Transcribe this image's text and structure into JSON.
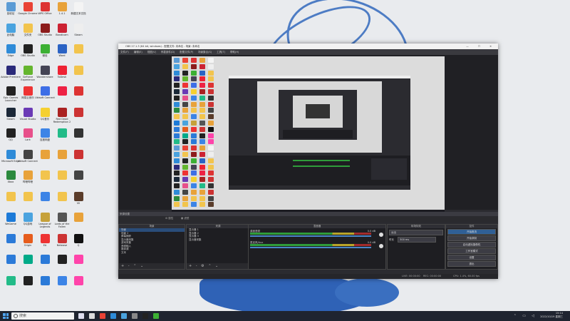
{
  "desktop_icons": [
    {
      "label": "回收站",
      "color": "#5b9bd5"
    },
    {
      "label": "Google Chrome",
      "color": "#e94235"
    },
    {
      "label": "WPS Office",
      "color": "#d33"
    },
    {
      "label": "1.4.1",
      "color": "#e8a23a"
    },
    {
      "label": "新建文本文档",
      "color": "#f4f4f4"
    },
    {
      "label": "此电脑",
      "color": "#4aa3df"
    },
    {
      "label": "文件夹",
      "color": "#f2c44d"
    },
    {
      "label": "OBS Studio",
      "color": "#8c1c1c"
    },
    {
      "label": "Bandicam",
      "color": "#c23"
    },
    {
      "label": "Steam",
      "color": "#eee"
    },
    {
      "label": "Edge",
      "color": "#2e8bd8"
    },
    {
      "label": "OBS Studio",
      "color": "#222"
    },
    {
      "label": "微信",
      "color": "#3cb034"
    },
    {
      "label": "Word",
      "color": "#2b63c4"
    },
    {
      "label": "",
      "color": "#f2c44d"
    },
    {
      "label": "Adobe Premiere",
      "color": "#2a2a7a"
    },
    {
      "label": "GeForce Experience",
      "color": "#64b52e"
    },
    {
      "label": "Wondershare",
      "color": "#445"
    },
    {
      "label": "ToDesk",
      "color": "#e23"
    },
    {
      "label": "",
      "color": "#f2c44d"
    },
    {
      "label": "Epic Games Launcher",
      "color": "#222"
    },
    {
      "label": "网易云音乐",
      "color": "#e33"
    },
    {
      "label": "Ubisoft Connect",
      "color": "#3d6ee6"
    },
    {
      "label": "",
      "color": "#e24"
    },
    {
      "label": "",
      "color": "#d33"
    },
    {
      "label": "Steam",
      "color": "#1b2838"
    },
    {
      "label": "Visual Studio",
      "color": "#6a3ab5"
    },
    {
      "label": "QQ音乐",
      "color": "#f5d030"
    },
    {
      "label": "Red Dead Redemption 2",
      "color": "#a22"
    },
    {
      "label": "",
      "color": "#c33"
    },
    {
      "label": "QQ",
      "color": "#222"
    },
    {
      "label": "Lark",
      "color": "#e7508a"
    },
    {
      "label": "百度网盘",
      "color": "#3c84e6"
    },
    {
      "label": "",
      "color": "#2b8"
    },
    {
      "label": "",
      "color": "#333"
    },
    {
      "label": "Microsoft Edge",
      "color": "#2e8bd8"
    },
    {
      "label": "Ubisoft Connect",
      "color": "#444"
    },
    {
      "label": "",
      "color": "#e8a23a"
    },
    {
      "label": "",
      "color": "#e8a23a"
    },
    {
      "label": "",
      "color": "#c33"
    },
    {
      "label": "Xbox",
      "color": "#2b8a3e"
    },
    {
      "label": "哔哩哔哩",
      "color": "#e8a23a"
    },
    {
      "label": "",
      "color": "#f2c44d"
    },
    {
      "label": "",
      "color": "#f2c44d"
    },
    {
      "label": "",
      "color": "#444"
    },
    {
      "label": "",
      "color": "#f2c44d"
    },
    {
      "label": "",
      "color": "#f2c44d"
    },
    {
      "label": "",
      "color": "#3c84e6"
    },
    {
      "label": "",
      "color": "#f2c44d"
    },
    {
      "label": "VII",
      "color": "#5a3c2a"
    },
    {
      "label": "WeGame",
      "color": "#1c7ad8"
    },
    {
      "label": "QQ游戏",
      "color": "#4aa3df"
    },
    {
      "label": "League of Legends",
      "color": "#c6a13a"
    },
    {
      "label": "Lords of the Fallen",
      "color": "#555"
    },
    {
      "label": "",
      "color": "#e8a23a"
    },
    {
      "label": "",
      "color": "#2b7ad8"
    },
    {
      "label": "Origin",
      "color": "#e65c1c"
    },
    {
      "label": "EA",
      "color": "#e33"
    },
    {
      "label": "Netease",
      "color": "#c33"
    },
    {
      "label": "Q",
      "color": "#111"
    },
    {
      "label": "",
      "color": "#2b7ad8"
    },
    {
      "label": "",
      "color": "#0a8"
    },
    {
      "label": "",
      "color": "#2b7ad8"
    },
    {
      "label": "",
      "color": "#222"
    },
    {
      "label": "",
      "color": "#f4a"
    },
    {
      "label": "",
      "color": "#2b8"
    },
    {
      "label": "",
      "color": "#222"
    },
    {
      "label": "",
      "color": "#2b7ad8"
    },
    {
      "label": "",
      "color": "#3c84e6"
    },
    {
      "label": "",
      "color": "#f4a"
    }
  ],
  "obs": {
    "title": "OBS 27.1.3 (64 bit, windows) - 配置文件: 未命名 - 场景: 未命名",
    "menu": [
      "文件(F)",
      "编辑(E)",
      "视图(V)",
      "停靠部件(D)",
      "配置文件(P)",
      "场景集合(S)",
      "工具(T)",
      "帮助(H)"
    ],
    "dock_title": "来源设置",
    "panels": {
      "scenes": {
        "title": "场景",
        "items": [
          "场景",
          "场景 2",
          "屏幕捕获",
          "显示器采集",
          "游戏采集",
          "音频输入",
          "媒体源",
          "文本"
        ],
        "footer": "+ - ⌃ ⌄"
      },
      "sources": {
        "title": "来源",
        "items": [
          "显示器 1",
          "显示器 2",
          "显示器 3",
          "显示器采集"
        ],
        "footer": "+ - ⚙ ⌃ ⌄"
      },
      "mixer": {
        "title": "混音器",
        "channels": [
          {
            "name": "桌面音频",
            "db": "0.0 dB"
          },
          {
            "name": "麦克风/Aux",
            "db": "0.0 dB"
          }
        ]
      },
      "transitions": {
        "title": "转场特效",
        "fade": "淡出",
        "duration_label": "时长",
        "duration": "300 ms"
      },
      "controls": {
        "title": "控件",
        "buttons": [
          "开始推流",
          "开始录制",
          "启动虚拟摄像机",
          "工作室模式",
          "设置",
          "退出"
        ]
      }
    },
    "status": {
      "live": "LIVE: 00:00:00",
      "rec": "REC: 00:00:00",
      "cpu": "CPU: 1.4%, 60.00 fps"
    }
  },
  "taskbar": {
    "search_placeholder": "搜索",
    "time": "15:14",
    "date": "2022/10/19 星期三",
    "icons": [
      {
        "color": "#dde"
      },
      {
        "color": "#ddd"
      },
      {
        "color": "#e94235"
      },
      {
        "color": "#2e8bd8"
      },
      {
        "color": "#4aa3df"
      },
      {
        "color": "#888"
      },
      {
        "color": "#222"
      },
      {
        "color": "#3cb034"
      }
    ]
  }
}
